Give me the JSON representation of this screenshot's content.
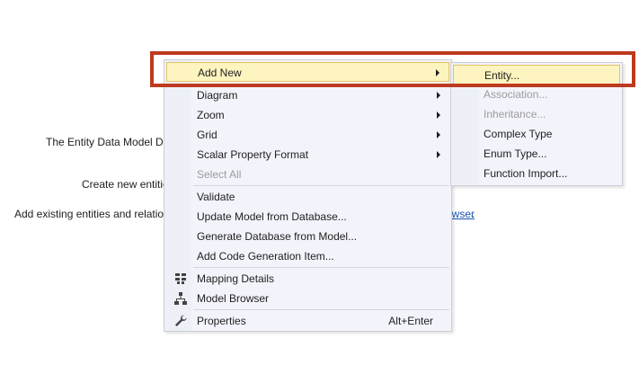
{
  "background": {
    "line1": "The Entity Data Model De",
    "line2": "Create new entitie",
    "line3": "Add existing entities and relatio",
    "link_fragment": "owser",
    "link_period": "."
  },
  "context_menu": {
    "items": [
      {
        "label": "Add New",
        "submenu": true
      },
      {
        "label": "Diagram",
        "submenu": true
      },
      {
        "label": "Zoom",
        "submenu": true
      },
      {
        "label": "Grid",
        "submenu": true
      },
      {
        "label": "Scalar Property Format",
        "submenu": true
      },
      {
        "label": "Select All",
        "disabled": true
      },
      {
        "label": "Validate"
      },
      {
        "label": "Update Model from Database..."
      },
      {
        "label": "Generate Database from Model..."
      },
      {
        "label": "Add Code Generation Item..."
      },
      {
        "label": "Mapping Details",
        "icon": "mapping-details-icon"
      },
      {
        "label": "Model Browser",
        "icon": "model-browser-icon"
      },
      {
        "label": "Properties",
        "icon": "wrench-icon",
        "shortcut": "Alt+Enter"
      }
    ]
  },
  "submenu": {
    "items": [
      {
        "label": "Entity..."
      },
      {
        "label": "Association...",
        "disabled": true
      },
      {
        "label": "Inheritance...",
        "disabled": true
      },
      {
        "label": "Complex Type"
      },
      {
        "label": "Enum Type..."
      },
      {
        "label": "Function Import..."
      }
    ]
  },
  "colors": {
    "highlight": "#fdf4bf",
    "highlight_border": "#e5c365",
    "annotation_box": "#be3a1e",
    "menu_bg": "#f3f4fb"
  }
}
